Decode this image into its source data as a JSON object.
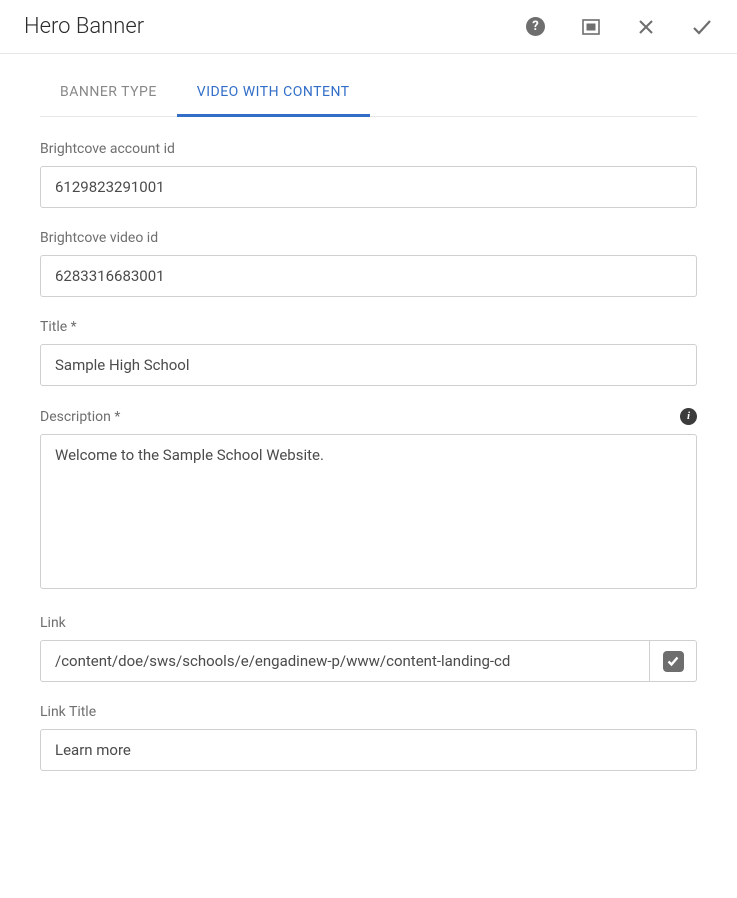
{
  "dialog": {
    "title": "Hero Banner"
  },
  "tabs": {
    "banner_type": "BANNER TYPE",
    "video_with_content": "VIDEO WITH CONTENT"
  },
  "fields": {
    "account_id": {
      "label": "Brightcove account id",
      "value": "6129823291001"
    },
    "video_id": {
      "label": "Brightcove video id",
      "value": "6283316683001"
    },
    "title": {
      "label": "Title *",
      "value": "Sample High School"
    },
    "description": {
      "label": "Description *",
      "value": "Welcome to the Sample School Website."
    },
    "link": {
      "label": "Link",
      "value": "/content/doe/sws/schools/e/engadinew-p/www/content-landing-cd"
    },
    "link_title": {
      "label": "Link Title",
      "value": "Learn more"
    }
  }
}
